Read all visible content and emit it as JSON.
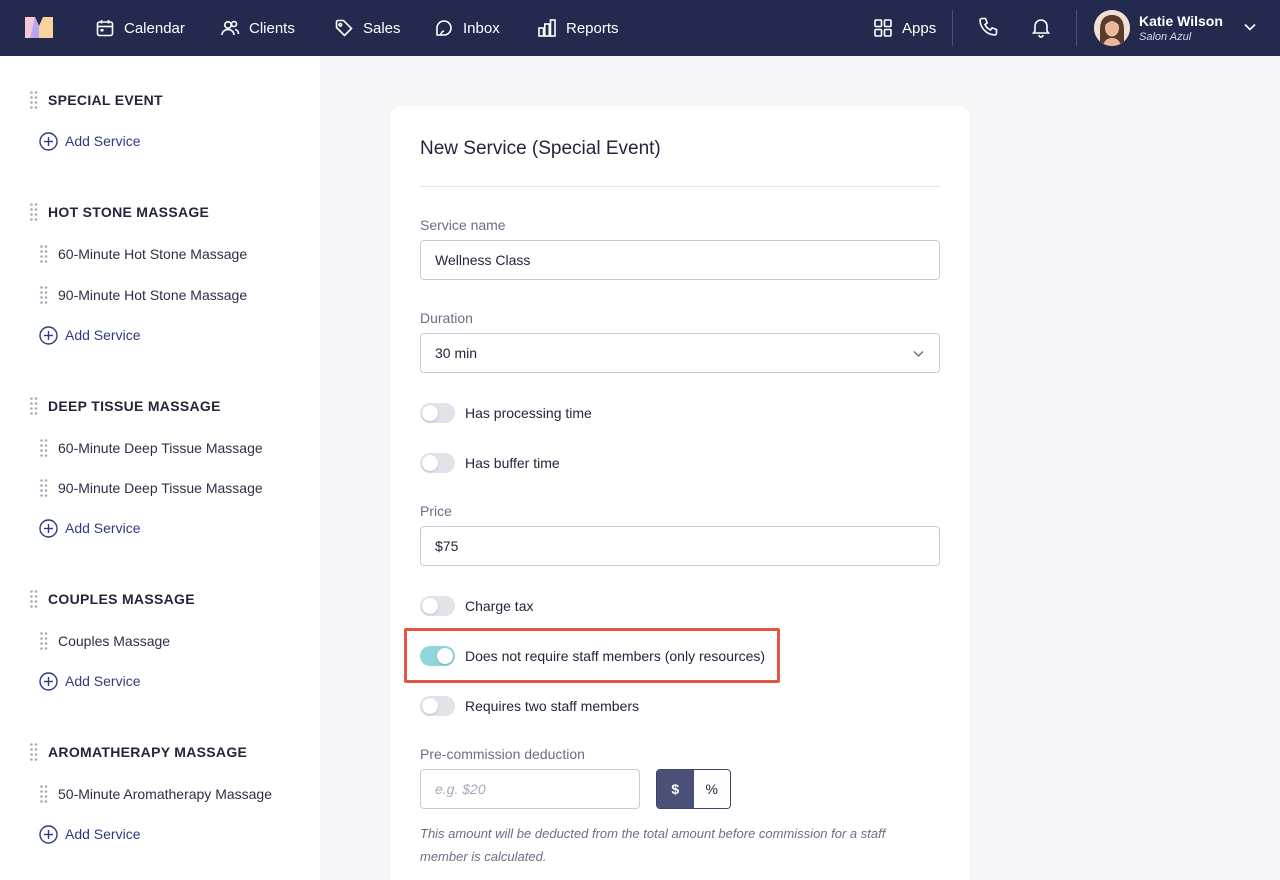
{
  "nav": {
    "items": [
      {
        "label": "Calendar",
        "icon": "calendar-icon"
      },
      {
        "label": "Clients",
        "icon": "clients-icon"
      },
      {
        "label": "Sales",
        "icon": "tag-icon"
      },
      {
        "label": "Inbox",
        "icon": "inbox-icon"
      },
      {
        "label": "Reports",
        "icon": "reports-icon"
      }
    ],
    "apps_label": "Apps",
    "user": {
      "name": "Katie Wilson",
      "salon": "Salon Azul"
    }
  },
  "sidebar": {
    "add_label": "Add Service",
    "categories": [
      {
        "title": "SPECIAL EVENT",
        "services": []
      },
      {
        "title": "HOT STONE MASSAGE",
        "services": [
          "60-Minute Hot Stone Massage",
          "90-Minute Hot Stone Massage"
        ]
      },
      {
        "title": "DEEP TISSUE MASSAGE",
        "services": [
          "60-Minute Deep Tissue Massage",
          "90-Minute Deep Tissue Massage"
        ]
      },
      {
        "title": "COUPLES MASSAGE",
        "services": [
          "Couples Massage"
        ]
      },
      {
        "title": "AROMATHERAPY MASSAGE",
        "services": [
          "50-Minute Aromatherapy Massage"
        ]
      }
    ]
  },
  "form": {
    "title": "New Service (Special Event)",
    "service_name_label": "Service name",
    "service_name_value": "Wellness Class",
    "duration_label": "Duration",
    "duration_value": "30 min",
    "processing_label": "Has processing time",
    "buffer_label": "Has buffer time",
    "price_label": "Price",
    "price_value": "$75",
    "charge_tax_label": "Charge tax",
    "no_staff_label": "Does not require staff members (only resources)",
    "two_staff_label": "Requires two staff members",
    "toggles": {
      "processing": false,
      "buffer": false,
      "charge_tax": false,
      "no_staff": true,
      "two_staff": false
    },
    "deduction_label": "Pre-commission deduction",
    "deduction_placeholder": "e.g. $20",
    "deduction_value": "",
    "unit_dollar": "$",
    "unit_percent": "%",
    "unit_selected": "$",
    "helper_text": "This amount will be deducted from the total amount before commission for a staff member is calculated."
  },
  "colors": {
    "nav_bg": "#232a4d",
    "toggle_on": "#8fd6dc",
    "link": "#2f3a80",
    "highlight": "#e2553f"
  }
}
